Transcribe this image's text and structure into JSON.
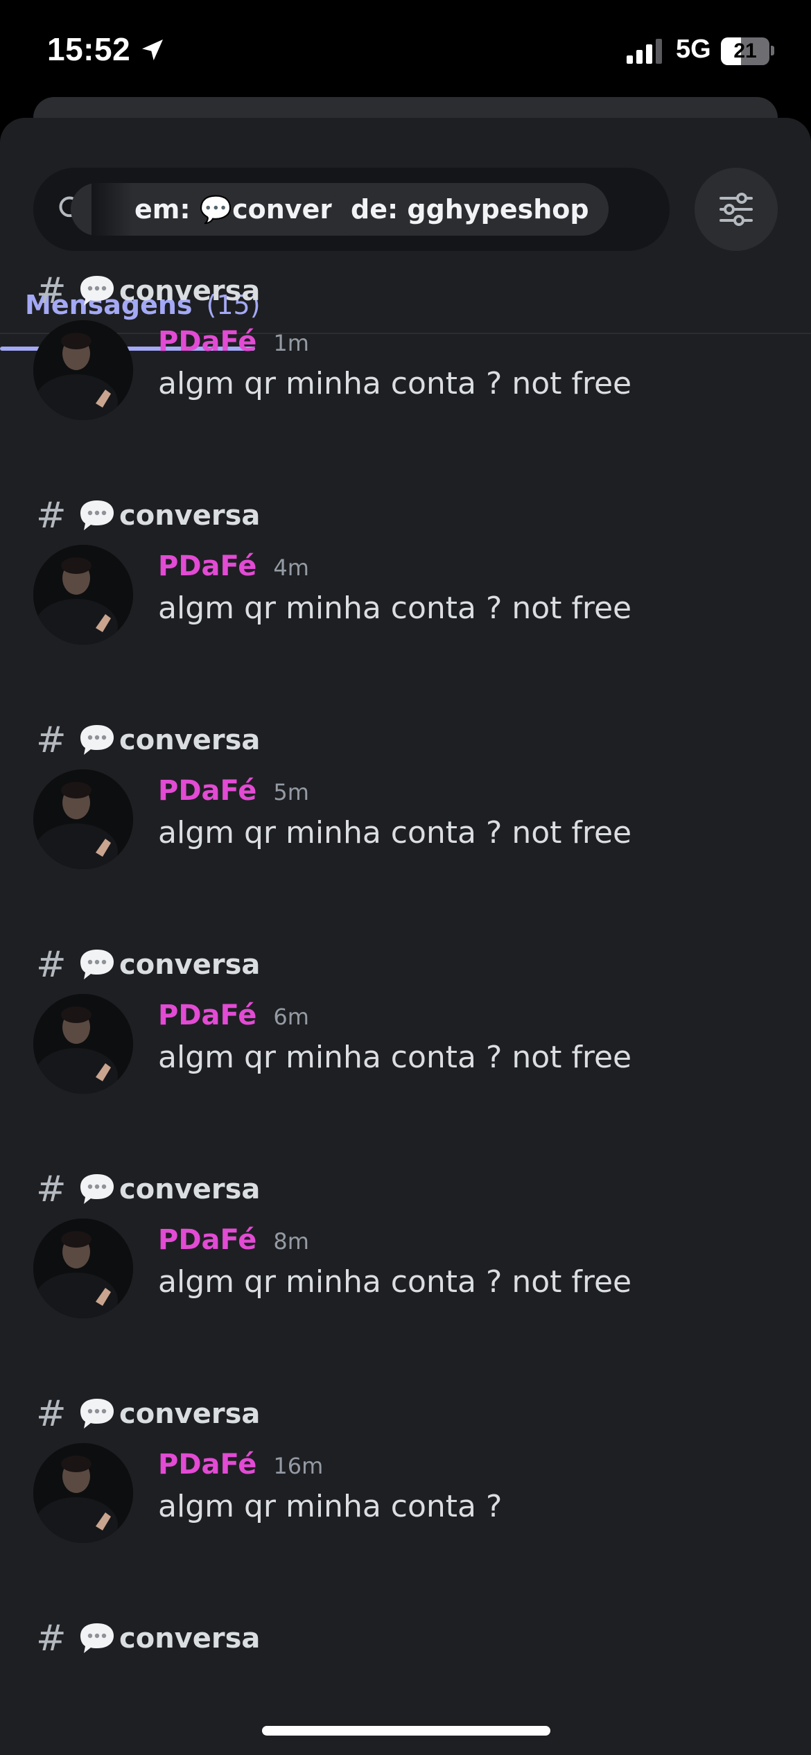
{
  "status_bar": {
    "time": "15:52",
    "network": "5G",
    "battery": "21",
    "battery_level": 0.21
  },
  "search": {
    "channel_filter": "em: 💬conversa",
    "user_filter": "de: gghypeshop"
  },
  "tabs": [
    {
      "label": "Mensagens",
      "count": "(15)"
    }
  ],
  "results": [
    {
      "channel": "conversa",
      "author": "PDaFé",
      "time": "1m",
      "text": "algm qr minha conta ? not free"
    },
    {
      "channel": "conversa",
      "author": "PDaFé",
      "time": "4m",
      "text": "algm qr minha conta ? not free"
    },
    {
      "channel": "conversa",
      "author": "PDaFé",
      "time": "5m",
      "text": "algm qr minha conta ? not free"
    },
    {
      "channel": "conversa",
      "author": "PDaFé",
      "time": "6m",
      "text": "algm qr minha conta ? not free"
    },
    {
      "channel": "conversa",
      "author": "PDaFé",
      "time": "8m",
      "text": "algm qr minha conta ? not free"
    },
    {
      "channel": "conversa",
      "author": "PDaFé",
      "time": "16m",
      "text": "algm qr minha conta ?"
    },
    {
      "channel": "conversa"
    }
  ],
  "colors": {
    "author": "#e24bd4",
    "accent": "#a4a9f5",
    "background": "#1e1f22"
  }
}
